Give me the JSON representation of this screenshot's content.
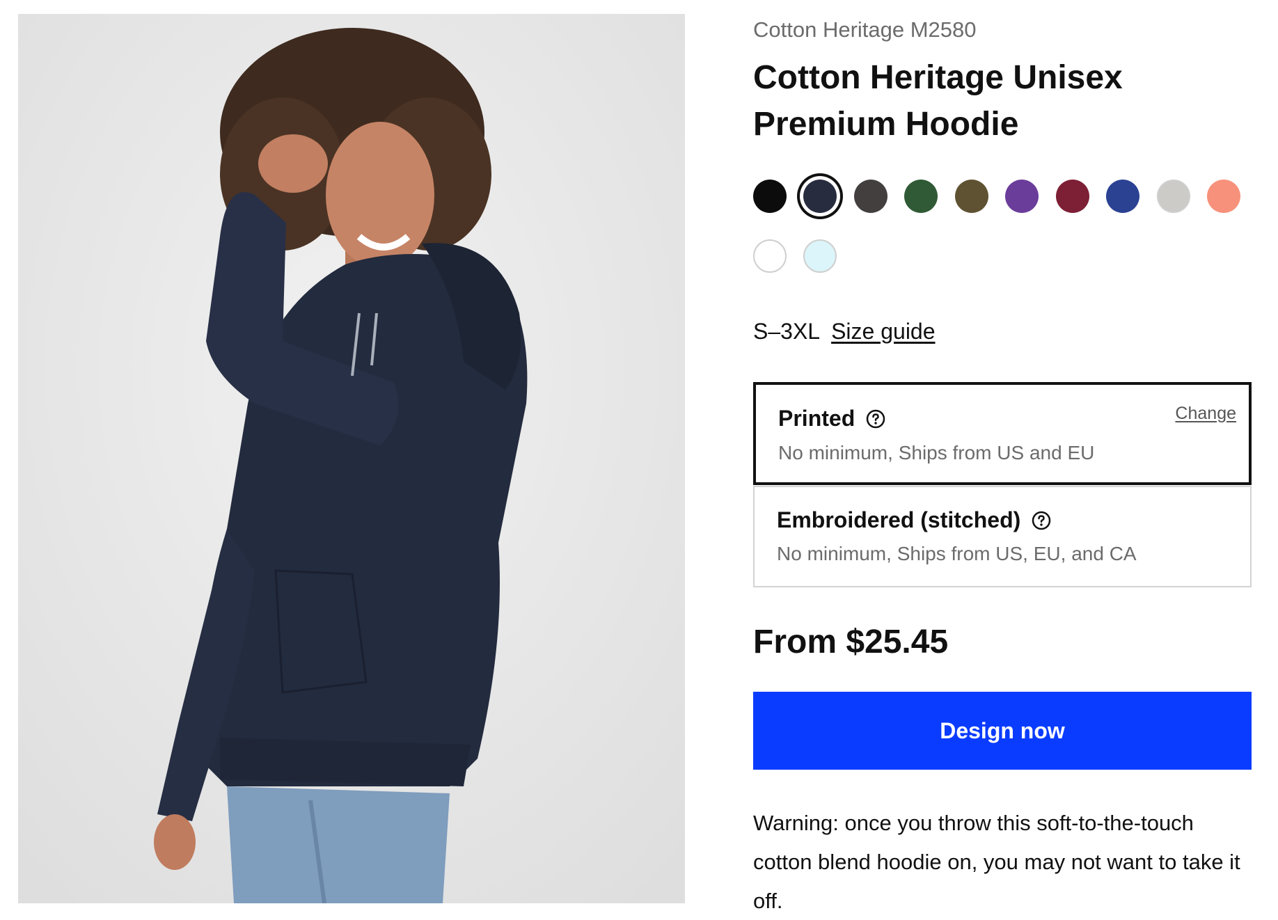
{
  "product": {
    "model": "Cotton Heritage M2580",
    "title": "Cotton Heritage Unisex Premium Hoodie",
    "image": "model-wearing-navy-hoodie"
  },
  "colors": {
    "swatches": [
      {
        "name": "Black",
        "hex": "#0c0c0c",
        "selected": false
      },
      {
        "name": "Navy",
        "hex": "#272c3f",
        "selected": true
      },
      {
        "name": "Charcoal",
        "hex": "#433f3f",
        "selected": false
      },
      {
        "name": "Forest Green",
        "hex": "#2f5a35",
        "selected": false
      },
      {
        "name": "Olive",
        "hex": "#5f5232",
        "selected": false
      },
      {
        "name": "Purple",
        "hex": "#6b3d9a",
        "selected": false
      },
      {
        "name": "Maroon",
        "hex": "#7d1f35",
        "selected": false
      },
      {
        "name": "Royal Blue",
        "hex": "#2b4293",
        "selected": false
      },
      {
        "name": "Light Grey",
        "hex": "#cdcbc7",
        "selected": false
      },
      {
        "name": "Coral",
        "hex": "#f7917b",
        "selected": false
      },
      {
        "name": "White",
        "hex": "#ffffff",
        "selected": false
      },
      {
        "name": "Light Blue",
        "hex": "#dcf5fa",
        "selected": false
      }
    ]
  },
  "sizes": {
    "range": "S–3XL",
    "guide_label": "Size guide"
  },
  "options": {
    "printed": {
      "label": "Printed",
      "subtitle": "No minimum, Ships from US and EU",
      "change_label": "Change",
      "selected": true
    },
    "embroidered": {
      "label": "Embroidered (stitched)",
      "subtitle": "No minimum, Ships from US, EU, and CA",
      "selected": false
    }
  },
  "pricing": {
    "label": "From $25.45"
  },
  "cta": {
    "label": "Design now",
    "color": "#0a3cff"
  },
  "description": "Warning: once you throw this soft-to-the-touch cotton blend hoodie on, you may not want to take it off."
}
